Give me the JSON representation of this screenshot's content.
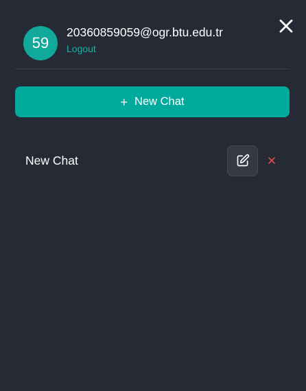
{
  "user": {
    "avatar_text": "59",
    "email": "20360859059@ogr.btu.edu.tr",
    "logout_label": "Logout"
  },
  "actions": {
    "new_chat_icon": "+",
    "new_chat_label": "New Chat"
  },
  "chats": [
    {
      "title": "New Chat"
    }
  ],
  "icons": {
    "close": "close-icon",
    "edit": "edit-icon",
    "delete": "delete-icon"
  },
  "colors": {
    "background": "#252a34",
    "accent": "#02a99d",
    "avatar": "#10a99b",
    "link": "#16b5a6",
    "delete": "#e04a4a"
  }
}
